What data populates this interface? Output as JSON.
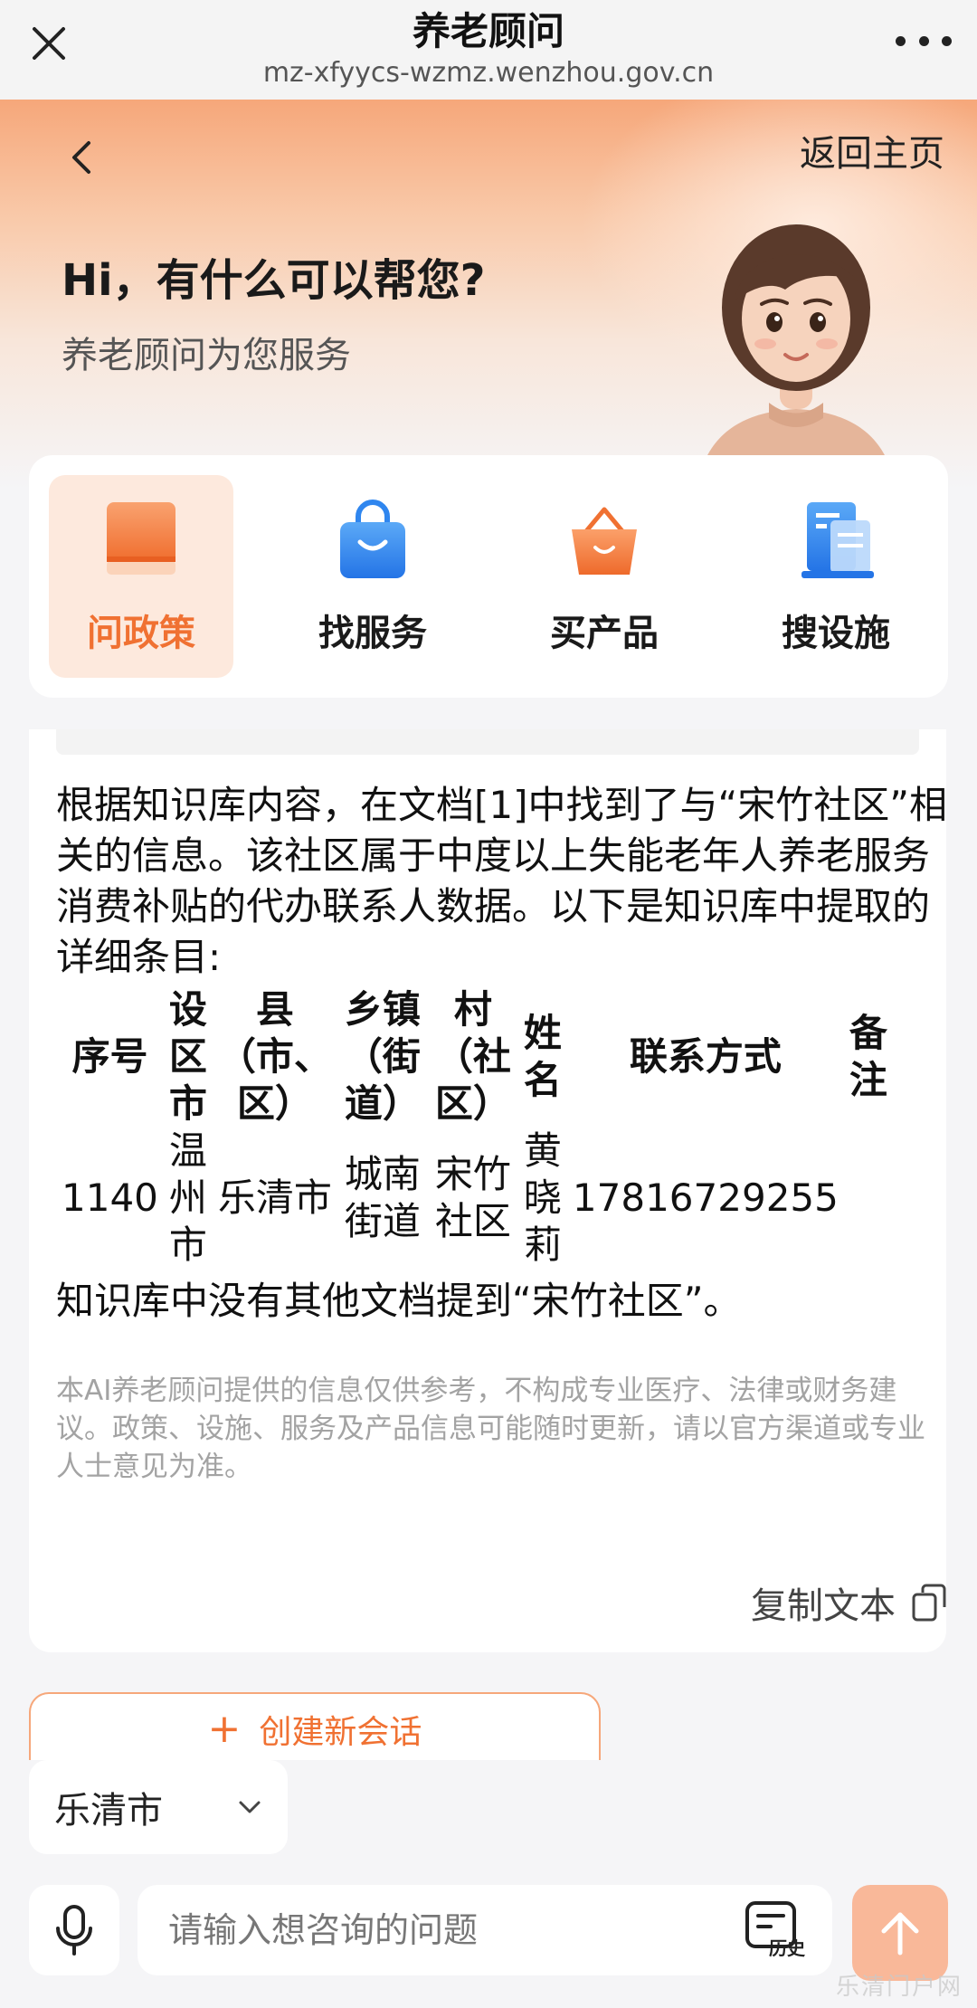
{
  "browser": {
    "title": "养老顾问",
    "url": "mz-xfyycs-wzmz.wenzhou.gov.cn"
  },
  "hero": {
    "home_link": "返回主页",
    "greeting": "Hi，有什么可以帮您?",
    "subtitle": "养老顾问为您服务"
  },
  "categories": [
    {
      "label": "问政策",
      "icon": "book-icon",
      "color": "#f07132",
      "active": true
    },
    {
      "label": "找服务",
      "icon": "shopping-bag-icon",
      "color": "#2f86ef",
      "active": false
    },
    {
      "label": "买产品",
      "icon": "basket-icon",
      "color": "#f47a37",
      "active": false
    },
    {
      "label": "搜设施",
      "icon": "building-document-icon",
      "color": "#2f86ef",
      "active": false
    }
  ],
  "message": {
    "intro": "根据知识库内容，在文档[1]中找到了与“宋竹社区”相关的信息。该社区属于中度以上失能老年人养老服务消费补贴的代办联系人数据。以下是知识库中提取的详细条目:",
    "table": {
      "headers": [
        "序号",
        "设区市",
        "县（市、区）",
        "乡镇（街道）",
        "村（社区）",
        "姓名",
        "联系方式",
        "备注"
      ],
      "rows": [
        [
          "1140",
          "温州市",
          "乐清市",
          "城南街道",
          "宋竹社区",
          "黄晓莉",
          "17816729255",
          ""
        ]
      ]
    },
    "closing": "知识库中没有其他文档提到“宋竹社区”。",
    "disclaimer": "本AI养老顾问提供的信息仅供参考，不构成专业医疗、法律或财务建议。政策、设施、服务及产品信息可能随时更新，请以官方渠道或专业人士意见为准。",
    "copy_label": "复制文本"
  },
  "new_session_label": "创建新会话",
  "city_select": {
    "value": "乐清市"
  },
  "input": {
    "placeholder": "请输入想咨询的问题",
    "history_label": "历史"
  },
  "watermark": "乐清门户网",
  "colors": {
    "accent": "#f07132",
    "accent_light": "#fde9dd",
    "blue": "#2f86ef",
    "send": "#f9b899"
  }
}
